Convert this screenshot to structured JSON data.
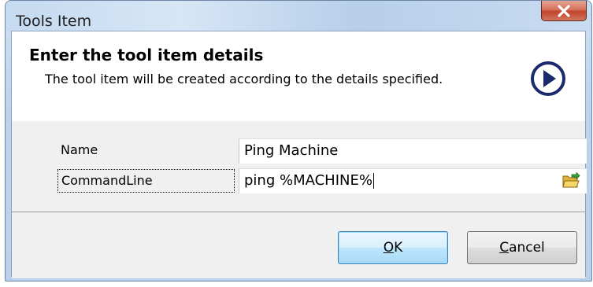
{
  "window": {
    "title": "Tools Item",
    "close_glyph": "X"
  },
  "header": {
    "title": "Enter the tool item details",
    "description": "The tool item will be created according to the details specified.",
    "icon": "next-arrow-circle-icon",
    "icon_color": "#1a2a6c"
  },
  "form": {
    "rows": [
      {
        "label": "Name",
        "value": "Ping Machine"
      },
      {
        "label": "CommandLine",
        "value": "ping %MACHINE%"
      }
    ],
    "browse_icon": "folder-open-icon"
  },
  "buttons": {
    "ok_mnemonic": "O",
    "ok_rest": "K",
    "cancel_mnemonic": "C",
    "cancel_rest": "ancel"
  },
  "colors": {
    "close_button": "#c7503a",
    "default_button_border": "#3c7fb1"
  }
}
